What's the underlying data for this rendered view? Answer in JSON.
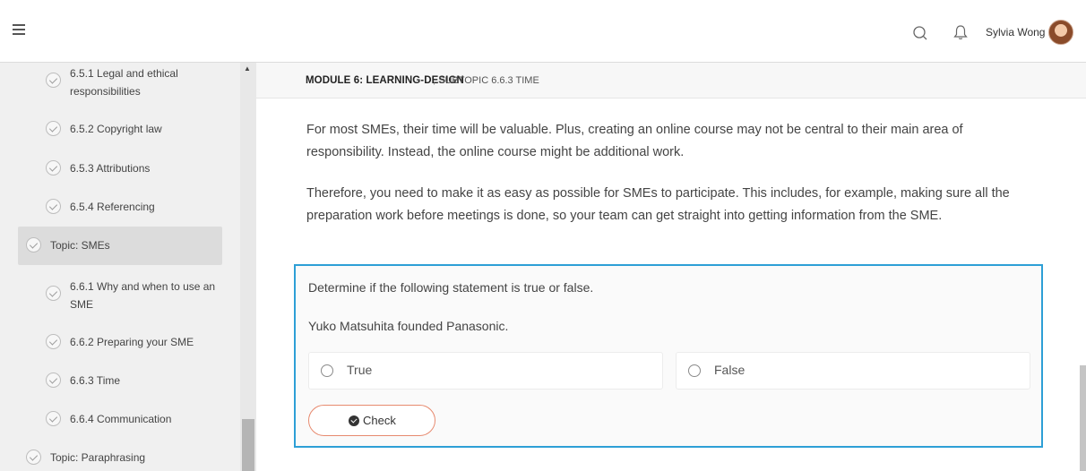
{
  "user": {
    "name": "Sylvia Wong"
  },
  "sidebar": {
    "items": [
      {
        "label": "6.5.1 Legal and ethical responsibilities",
        "kind": "sub"
      },
      {
        "label": "6.5.2 Copyright law",
        "kind": "sub"
      },
      {
        "label": "6.5.3 Attributions",
        "kind": "sub"
      },
      {
        "label": "6.5.4 Referencing",
        "kind": "sub"
      },
      {
        "label": "Topic: SMEs",
        "kind": "topic",
        "active": true
      },
      {
        "label": "6.6.1 Why and when to use an SME",
        "kind": "sub"
      },
      {
        "label": "6.6.2 Preparing your SME",
        "kind": "sub"
      },
      {
        "label": "6.6.3 Time",
        "kind": "sub"
      },
      {
        "label": "6.6.4 Communication",
        "kind": "sub"
      },
      {
        "label": "Topic: Paraphrasing",
        "kind": "topic"
      }
    ]
  },
  "breadcrumb": {
    "module": "MODULE 6: LEARNING-DESIGN",
    "subtopic": ", SUBTOPIC 6.6.3 TIME"
  },
  "content": {
    "paragraphs": [
      "For most SMEs, their time will be valuable. Plus, creating an online course may not be central to their main area of responsibility. Instead, the online course might be additional work.",
      "Therefore, you need to make it as easy as possible for SMEs to participate. This includes, for example, making sure all the preparation work before meetings is done, so your team can get straight into getting information from the SME."
    ]
  },
  "quiz": {
    "instruction": "Determine if the following statement is true or false.",
    "statement": "Yuko Matsuhita founded Panasonic.",
    "options": [
      "True",
      "False"
    ],
    "check_label": "Check"
  },
  "colors": {
    "quiz_border": "#2d9fd6",
    "check_border": "#e78a6f"
  }
}
